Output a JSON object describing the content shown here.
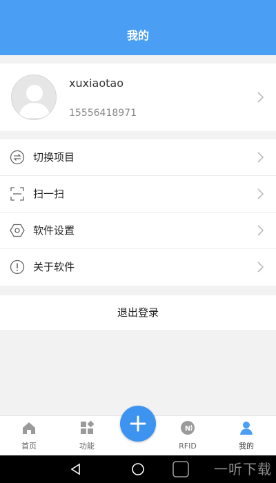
{
  "header": {
    "title": "我的"
  },
  "profile": {
    "username": "xuxiaotao",
    "phone": "15556418971"
  },
  "menu": {
    "items": [
      {
        "label": "切换项目",
        "icon": "switch-icon"
      },
      {
        "label": "扫一扫",
        "icon": "scan-icon"
      },
      {
        "label": "软件设置",
        "icon": "settings-icon"
      },
      {
        "label": "关于软件",
        "icon": "info-icon"
      }
    ]
  },
  "logout": {
    "label": "退出登录"
  },
  "tabbar": {
    "items": [
      {
        "label": "首页",
        "icon": "home-icon"
      },
      {
        "label": "功能",
        "icon": "grid-icon"
      },
      {
        "label": "RFID",
        "icon": "rfid-icon"
      },
      {
        "label": "我的",
        "icon": "user-icon",
        "active": true
      }
    ],
    "center_button": "plus-icon"
  },
  "watermark": {
    "text": "一听下载"
  },
  "colors": {
    "accent": "#4a9ef3",
    "fab": "#3d93f0",
    "background": "#f2f2f2"
  }
}
